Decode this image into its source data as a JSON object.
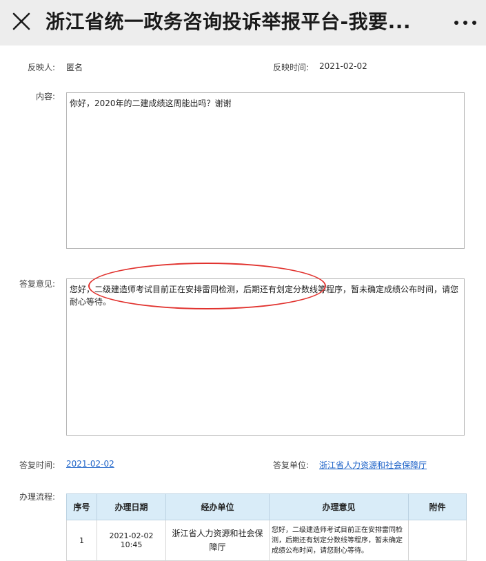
{
  "nav": {
    "title": "浙江省统一政务咨询投诉举报平台-我要...",
    "close_icon": "close-icon",
    "more_icon": "more-icon"
  },
  "form": {
    "reporter_label": "反映人:",
    "reporter_value": "匿名",
    "time_label": "反映时间:",
    "time_value": "2021-02-02",
    "content_label": "内容:",
    "content_value": "你好，2020年的二建成绩这周能出吗？谢谢",
    "reply_label": "答复意见:",
    "reply_value": "您好，二级建造师考试目前正在安排雷同检测，后期还有划定分数线等程序，暂未确定成绩公布时间，请您耐心等待。",
    "reply_time_label": "答复时间:",
    "reply_time_value": "2021-02-02",
    "reply_unit_label": "答复单位:",
    "reply_unit_value": "浙江省人力资源和社会保障厅",
    "flow_label": "办理流程:"
  },
  "flow_table": {
    "headers": [
      "序号",
      "办理日期",
      "经办单位",
      "办理意见",
      "附件"
    ],
    "rows": [
      {
        "no": "1",
        "date": "2021-02-02 10:45",
        "unit": "浙江省人力资源和社会保障厅",
        "opinion": "您好，二级建造师考试目前正在安排雷同检测，后期还有划定分数线等程序，暂未确定成绩公布时间，请您耐心等待。",
        "attachment": ""
      }
    ]
  },
  "colors": {
    "topbar": "#ededed",
    "link": "#1e63c8",
    "annotation_oval": "#e1322e",
    "table_header": "#d9ecf8"
  }
}
